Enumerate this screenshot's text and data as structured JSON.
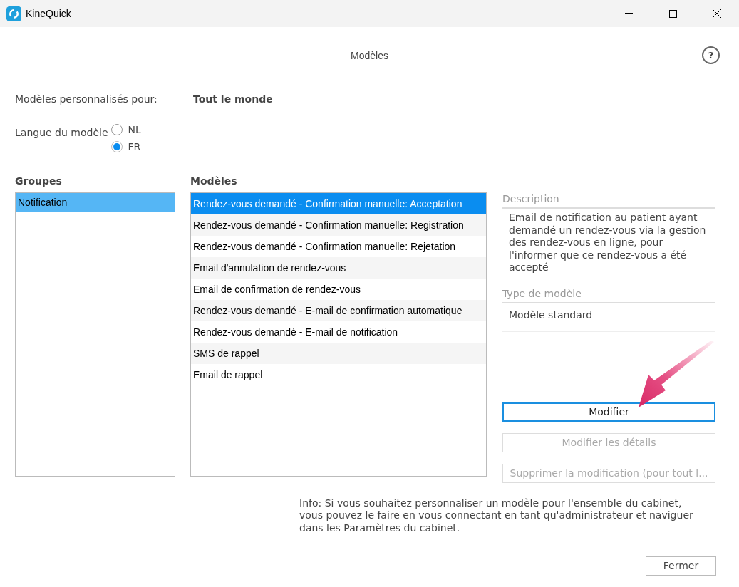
{
  "window": {
    "title": "KineQuick"
  },
  "dialog_title": "Modèles",
  "help_button": "?",
  "personalized_for": {
    "label": "Modèles personnalisés pour:",
    "value": "Tout le monde"
  },
  "language": {
    "label": "Langue du modèle",
    "options": [
      {
        "label": "NL",
        "selected": false
      },
      {
        "label": "FR",
        "selected": true
      }
    ]
  },
  "groups": {
    "heading": "Groupes",
    "items": [
      {
        "label": "Notification",
        "selected": true
      }
    ]
  },
  "models": {
    "heading": "Modèles",
    "items": [
      {
        "label": "Rendez-vous demandé - Confirmation manuelle: Acceptation",
        "selected": true
      },
      {
        "label": "Rendez-vous demandé - Confirmation manuelle: Registration",
        "selected": false
      },
      {
        "label": "Rendez-vous demandé - Confirmation manuelle: Rejetation",
        "selected": false
      },
      {
        "label": "Email d'annulation de rendez-vous",
        "selected": false
      },
      {
        "label": "Email de confirmation de rendez-vous",
        "selected": false
      },
      {
        "label": "Rendez-vous demandé - E-mail de confirmation automatique",
        "selected": false
      },
      {
        "label": "Rendez-vous demandé - E-mail de notification",
        "selected": false
      },
      {
        "label": "SMS de rappel",
        "selected": false
      },
      {
        "label": "Email de rappel",
        "selected": false
      }
    ]
  },
  "description": {
    "label": "Description",
    "value": "Email de notification au patient ayant demandé un rendez-vous via la gestion des rendez-vous en ligne, pour l'informer que ce rendez-vous a été accepté"
  },
  "model_type": {
    "label": "Type de modèle",
    "value": "Modèle standard"
  },
  "actions": [
    {
      "label": "Modifier",
      "disabled": false
    },
    {
      "label": "Modifier les détails",
      "disabled": true
    },
    {
      "label": "Supprimer la modification (pour tout l...",
      "disabled": true
    }
  ],
  "info": "Info: Si vous souhaitez personnaliser un modèle pour l'ensemble du cabinet, vous pouvez le faire en vous connectant en tant qu'administrateur et naviguer dans les Paramètres du cabinet.",
  "close_button": "Fermer"
}
